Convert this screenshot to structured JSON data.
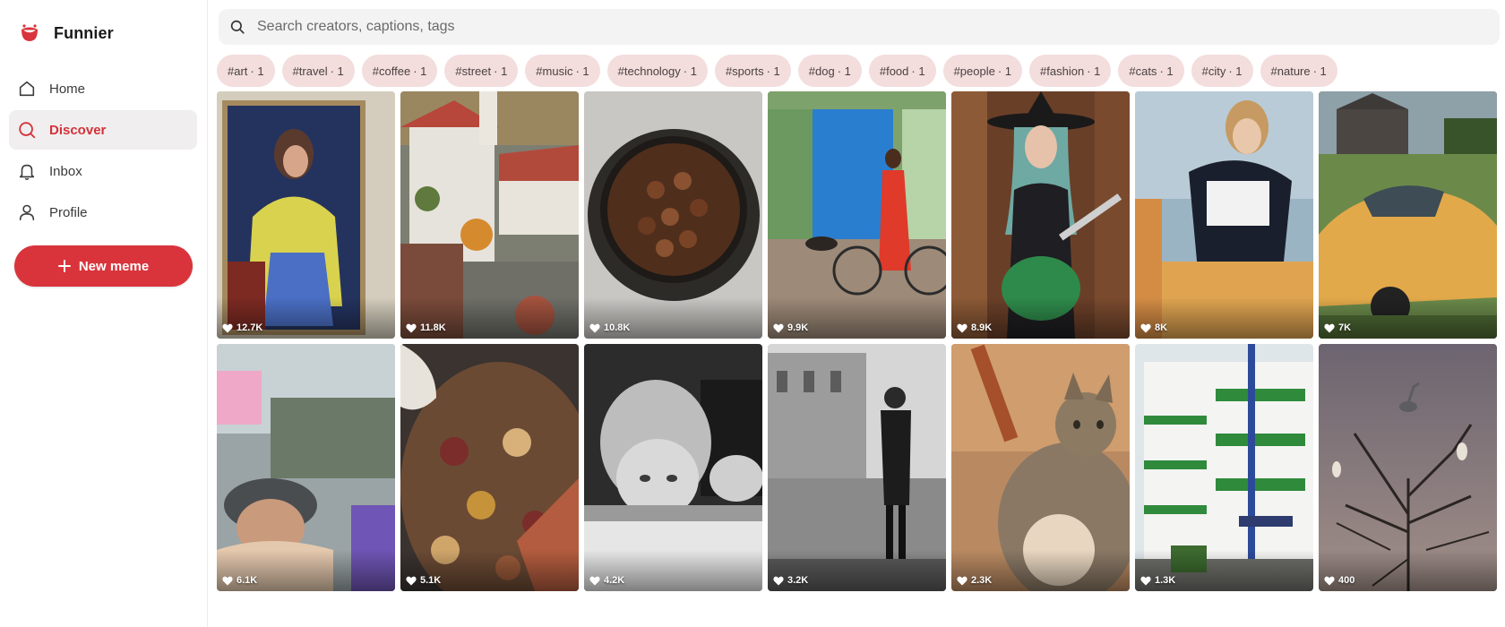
{
  "app": {
    "name": "Funnier",
    "logo_icon": "smile-logo-icon",
    "accent": "#d9343c"
  },
  "sidebar": {
    "items": [
      {
        "label": "Home",
        "icon": "home-icon",
        "active": false
      },
      {
        "label": "Discover",
        "icon": "search-icon",
        "active": true
      },
      {
        "label": "Inbox",
        "icon": "bell-icon",
        "active": false
      },
      {
        "label": "Profile",
        "icon": "user-icon",
        "active": false
      }
    ],
    "new_button": {
      "label": "New meme",
      "icon": "plus-icon"
    }
  },
  "search": {
    "placeholder": "Search creators, captions, tags",
    "icon": "search-icon"
  },
  "tags": [
    {
      "name": "#art",
      "count": "· 1"
    },
    {
      "name": "#travel",
      "count": "· 1"
    },
    {
      "name": "#coffee",
      "count": "· 1"
    },
    {
      "name": "#street",
      "count": "· 1"
    },
    {
      "name": "#music",
      "count": "· 1"
    },
    {
      "name": "#technology",
      "count": "· 1"
    },
    {
      "name": "#sports",
      "count": "· 1"
    },
    {
      "name": "#dog",
      "count": "· 1"
    },
    {
      "name": "#food",
      "count": "· 1"
    },
    {
      "name": "#people",
      "count": "· 1"
    },
    {
      "name": "#fashion",
      "count": "· 1"
    },
    {
      "name": "#cats",
      "count": "· 1"
    },
    {
      "name": "#city",
      "count": "· 1"
    },
    {
      "name": "#nature",
      "count": "· 1"
    }
  ],
  "posts": [
    {
      "likes": "12.7K",
      "subject": "painting-portrait"
    },
    {
      "likes": "11.8K",
      "subject": "castle-courtyard"
    },
    {
      "likes": "10.8K",
      "subject": "coffee-beans"
    },
    {
      "likes": "9.9K",
      "subject": "street-woman-bicycle"
    },
    {
      "likes": "8.9K",
      "subject": "guitarist-witch"
    },
    {
      "likes": "8K",
      "subject": "woman-table-game"
    },
    {
      "likes": "7K",
      "subject": "yellow-car"
    },
    {
      "likes": "6.1K",
      "subject": "photographer-fair"
    },
    {
      "likes": "5.1K",
      "subject": "paella-pan"
    },
    {
      "likes": "4.2K",
      "subject": "child-portrait-bw"
    },
    {
      "likes": "3.2K",
      "subject": "man-phone-bw"
    },
    {
      "likes": "2.3K",
      "subject": "tabby-cat"
    },
    {
      "likes": "1.3K",
      "subject": "green-balcony-building"
    },
    {
      "likes": "400",
      "subject": "heron-tree"
    }
  ]
}
